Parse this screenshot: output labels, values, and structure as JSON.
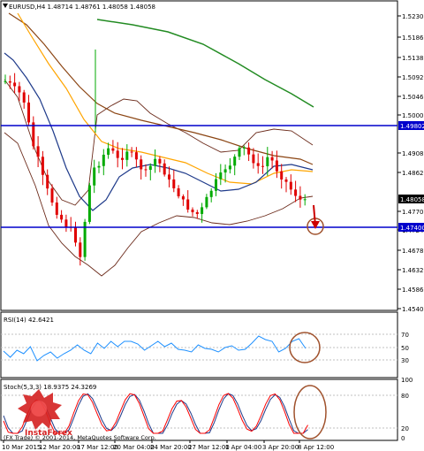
{
  "symbol_header": "EURUSD,H4  1.48714 1.48761 1.48058 1.48058",
  "price_axis": [
    "1.52300",
    "1.51860",
    "1.51380",
    "1.50920",
    "1.50460",
    "1.50000",
    "1.49080",
    "1.48620",
    "1.47700",
    "1.47240",
    "1.46780",
    "1.46320",
    "1.45860",
    "1.45400"
  ],
  "levels": {
    "resistance": "1.49802",
    "current": "1.48058",
    "support": "1.47400"
  },
  "rsi": {
    "label": "RSI(14) 42.6421",
    "ticks": [
      "70",
      "50",
      "30"
    ]
  },
  "stoch": {
    "label": "Stoch(5,3,3) 18.9375 24.3269",
    "ticks": [
      "100",
      "80",
      "20",
      "0"
    ]
  },
  "time_axis": [
    "10 Mar 2015",
    "12 Mar 20:00",
    "17 Mar 12:00",
    "20 Mar 04:00",
    "24 Mar 20:00",
    "27 Mar 12:00",
    "1 Apr 04:00",
    "3 Apr 20:00",
    "8 Apr 12:00"
  ],
  "copyright": "(FX Trade) © 2001-2014, MetaQuotes Software Corp.",
  "logo_text": "InstaForex",
  "colors": {
    "candle_up": "#00aa00",
    "candle_down": "#e00000",
    "ma_long": "#228b22",
    "ma_mid": "#8b4513",
    "ma_short": "#ffa500",
    "ma_fast": "#1e3a8a",
    "bands": "#6b2a1a",
    "hline": "#0000cc",
    "rsi_line": "#1e90ff",
    "stoch_main": "#1e3a8a",
    "stoch_signal": "#ff0000",
    "marker": "#a0522d"
  }
}
